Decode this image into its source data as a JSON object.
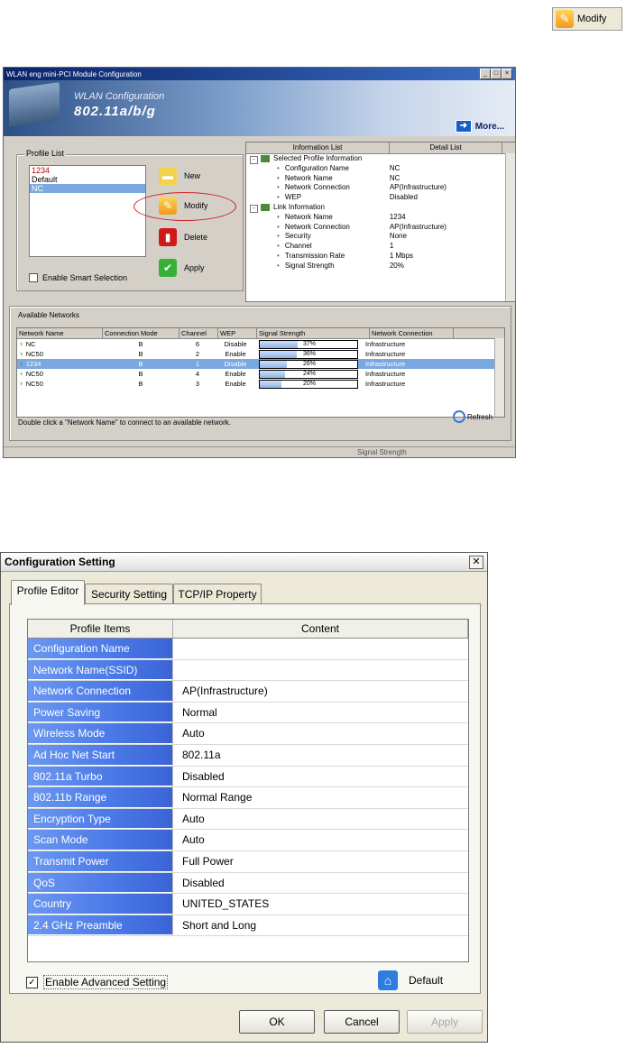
{
  "modify_chip": {
    "label": "Modify",
    "icon": "wrench-icon"
  },
  "win1": {
    "title": "WLAN eng mini-PCI Module Configuration",
    "banner_line1": "WLAN Configuration",
    "banner_line2": "802.11a/b/g",
    "more_label": "More...",
    "profile_list": {
      "label": "Profile List",
      "items": [
        "1234",
        "Default",
        "NC"
      ],
      "selected": "NC",
      "buttons": {
        "new": "New",
        "modify": "Modify",
        "delete": "Delete",
        "apply": "Apply"
      },
      "smart_selection": "Enable Smart Selection"
    },
    "info": {
      "col1": "Information List",
      "col2": "Detail List",
      "rows": [
        {
          "kind": "group",
          "label": "Selected Profile Information",
          "value": ""
        },
        {
          "kind": "item",
          "label": "Configuration Name",
          "value": "NC"
        },
        {
          "kind": "item",
          "label": "Network Name",
          "value": "NC"
        },
        {
          "kind": "item",
          "label": "Network Connection",
          "value": "AP(Infrastructure)"
        },
        {
          "kind": "item",
          "label": "WEP",
          "value": "Disabled"
        },
        {
          "kind": "group",
          "label": "Link Information",
          "value": ""
        },
        {
          "kind": "item",
          "label": "Network Name",
          "value": "1234"
        },
        {
          "kind": "item",
          "label": "Network Connection",
          "value": "AP(Infrastructure)"
        },
        {
          "kind": "item",
          "label": "Security",
          "value": "None"
        },
        {
          "kind": "item",
          "label": "Channel",
          "value": "1"
        },
        {
          "kind": "item",
          "label": "Transmission Rate",
          "value": "1 Mbps"
        },
        {
          "kind": "item",
          "label": "Signal Strength",
          "value": "20%"
        }
      ]
    },
    "available": {
      "label": "Available Networks",
      "headers": [
        "Network Name",
        "Connection Mode",
        "Channel",
        "WEP",
        "Signal Strength",
        "Network Connection"
      ],
      "rows": [
        {
          "name": "NC",
          "mode": "B",
          "channel": "6",
          "wep": "Disable",
          "signal": "37%",
          "conn": "Infrastructure"
        },
        {
          "name": "NC50",
          "mode": "B",
          "channel": "2",
          "wep": "Enable",
          "signal": "36%",
          "conn": "Infrastructure"
        },
        {
          "name": "1234",
          "mode": "B",
          "channel": "1",
          "wep": "Disable",
          "signal": "26%",
          "conn": "Infrastructure"
        },
        {
          "name": "NC50",
          "mode": "B",
          "channel": "4",
          "wep": "Enable",
          "signal": "24%",
          "conn": "Infrastructure"
        },
        {
          "name": "NC50",
          "mode": "B",
          "channel": "3",
          "wep": "Enable",
          "signal": "20%",
          "conn": "Infrastructure"
        }
      ],
      "selected_row": 2,
      "hint": "Double click a \"Network Name\" to connect to an available network.",
      "refresh": "Refresh"
    },
    "status": "Signal Strength"
  },
  "win2": {
    "title": "Configuration Setting",
    "tabs": [
      "Profile Editor",
      "Security Setting",
      "TCP/IP Property"
    ],
    "active_tab": 0,
    "table": {
      "col1": "Profile Items",
      "col2": "Content",
      "rows": [
        {
          "key": "Configuration Name",
          "value": ""
        },
        {
          "key": "Network Name(SSID)",
          "value": ""
        },
        {
          "key": "Network Connection",
          "value": "AP(Infrastructure)"
        },
        {
          "key": "Power Saving",
          "value": "Normal"
        },
        {
          "key": "Wireless Mode",
          "value": "Auto"
        },
        {
          "key": "Ad Hoc Net Start",
          "value": "802.11a"
        },
        {
          "key": "802.11a Turbo",
          "value": "Disabled"
        },
        {
          "key": "802.11b Range",
          "value": "Normal Range"
        },
        {
          "key": "Encryption Type",
          "value": "Auto"
        },
        {
          "key": "Scan Mode",
          "value": "Auto"
        },
        {
          "key": "Transmit Power",
          "value": "Full Power"
        },
        {
          "key": "QoS",
          "value": "Disabled"
        },
        {
          "key": "Country",
          "value": "UNITED_STATES"
        },
        {
          "key": "2.4 GHz Preamble",
          "value": "Short and Long"
        }
      ]
    },
    "advanced_label": "Enable Advanced Setting",
    "advanced_checked": true,
    "default_label": "Default",
    "buttons": {
      "ok": "OK",
      "cancel": "Cancel",
      "apply": "Apply"
    }
  }
}
